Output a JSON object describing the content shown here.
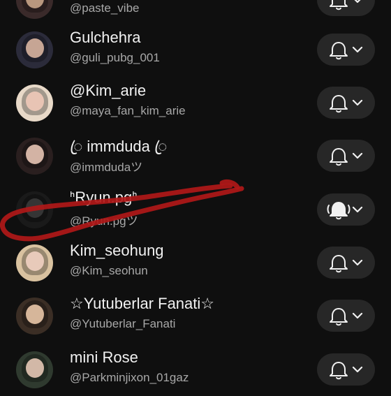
{
  "subscriptions": [
    {
      "name": "",
      "handle": "@paste_vibe",
      "notify": "default",
      "avatar_colors": [
        "#3a2a2a",
        "#c9a58a"
      ]
    },
    {
      "name": "Gulchehra",
      "handle": "@guli_pubg_001",
      "notify": "default",
      "avatar_colors": [
        "#2b2b3a",
        "#d8b4a0"
      ]
    },
    {
      "name": "@Kim_arie",
      "handle": "@maya_fan_kim_arie",
      "notify": "default",
      "avatar_colors": [
        "#e8d9c8",
        "#f0c9b8"
      ]
    },
    {
      "name": "ꦿ immduda ꦿ",
      "handle": "@immdudaツ",
      "notify": "default",
      "avatar_colors": [
        "#2a1f1f",
        "#e8c4b4"
      ]
    },
    {
      "name": "ᑋRyun.pgᑋ",
      "handle": "@Ryun.pgツ",
      "notify": "all",
      "avatar_colors": [
        "#1a1a1a",
        "#3a3a3a"
      ]
    },
    {
      "name": "Kim_seohung",
      "handle": "@Kim_seohun",
      "notify": "default",
      "avatar_colors": [
        "#d9c2a0",
        "#f1d2c2"
      ]
    },
    {
      "name": "☆Yutuberlar Fanati☆",
      "handle": "@Yutuberlar_Fanati",
      "notify": "default",
      "avatar_colors": [
        "#3b2e25",
        "#e9c7a8"
      ]
    },
    {
      "name": "mini Rose",
      "handle": "@Parkminjixon_01gaz",
      "notify": "default",
      "avatar_colors": [
        "#2f3a2f",
        "#e6c8b6"
      ]
    }
  ],
  "colors": {
    "background": "#0f0f0f",
    "button_bg": "#272727",
    "annotation": "#b01818"
  }
}
